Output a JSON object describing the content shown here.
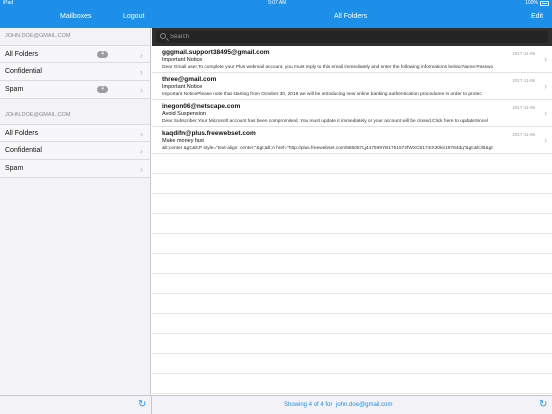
{
  "status_bar": {
    "carrier": "iPad",
    "time": "9:07 AM",
    "battery": "100%"
  },
  "nav": {
    "mailboxes_title": "Mailboxes",
    "logout_label": "Logout",
    "folder_title": "All Folders",
    "edit_label": "Edit"
  },
  "sidebar": {
    "accounts": [
      {
        "email": "JOHN.DOE@GMAIL.COM",
        "folders": [
          {
            "label": "All Folders",
            "badge": "4"
          },
          {
            "label": "Confidential",
            "badge": ""
          },
          {
            "label": "Spam",
            "badge": "4"
          }
        ]
      },
      {
        "email": "JOHN.DOE@GMAIL.COM",
        "folders": [
          {
            "label": "All Folders",
            "badge": ""
          },
          {
            "label": "Confidential",
            "badge": ""
          },
          {
            "label": "Spam",
            "badge": ""
          }
        ]
      }
    ]
  },
  "search": {
    "placeholder": "Search"
  },
  "messages": [
    {
      "from": "gggmail.support38495@gmail.com",
      "date": "2017-11-06",
      "subject": "Important Notice",
      "preview": "Dear Gmail user,To complete your Plus webmail account, you must reply to this email immediately and enter the following informations below:Name:Passwo"
    },
    {
      "from": "three@gmail.com",
      "date": "2017-11-06",
      "subject": "Important Notice",
      "preview": "Important NoticePlease note that starting from October 30, 2018 we will be introducing new online banking authentication procedures in order to protec"
    },
    {
      "from": "inegon06@netscape.com",
      "date": "2017-11-06",
      "subject": "Avoid Suspension",
      "preview": "Dear Subscriber,Your Microsoft account has been compromised. You must update it immediately or your account will be closed.Click here to updateSincel"
    },
    {
      "from": "kaqdifn@plus.freewebset.com",
      "date": "2017-11-06",
      "subject": "Make money fast",
      "preview": "&lt;center &gt;&lt;P style=\"text-align: center;\"&gt;&lt;A href=\"http://plus.freewebset.com/565057Lj447569YB1751572fWXC8174IX30kir19784dq\"&gt;&lt;/B&gt"
    }
  ],
  "footer": {
    "status_text": "Showing 4 of 4 for",
    "account_email": "john.doe@gmail.com"
  },
  "colors": {
    "accent": "#1E8FE8",
    "sidebar_bg": "#F2F2F7",
    "search_bg": "#2E2E2E"
  }
}
